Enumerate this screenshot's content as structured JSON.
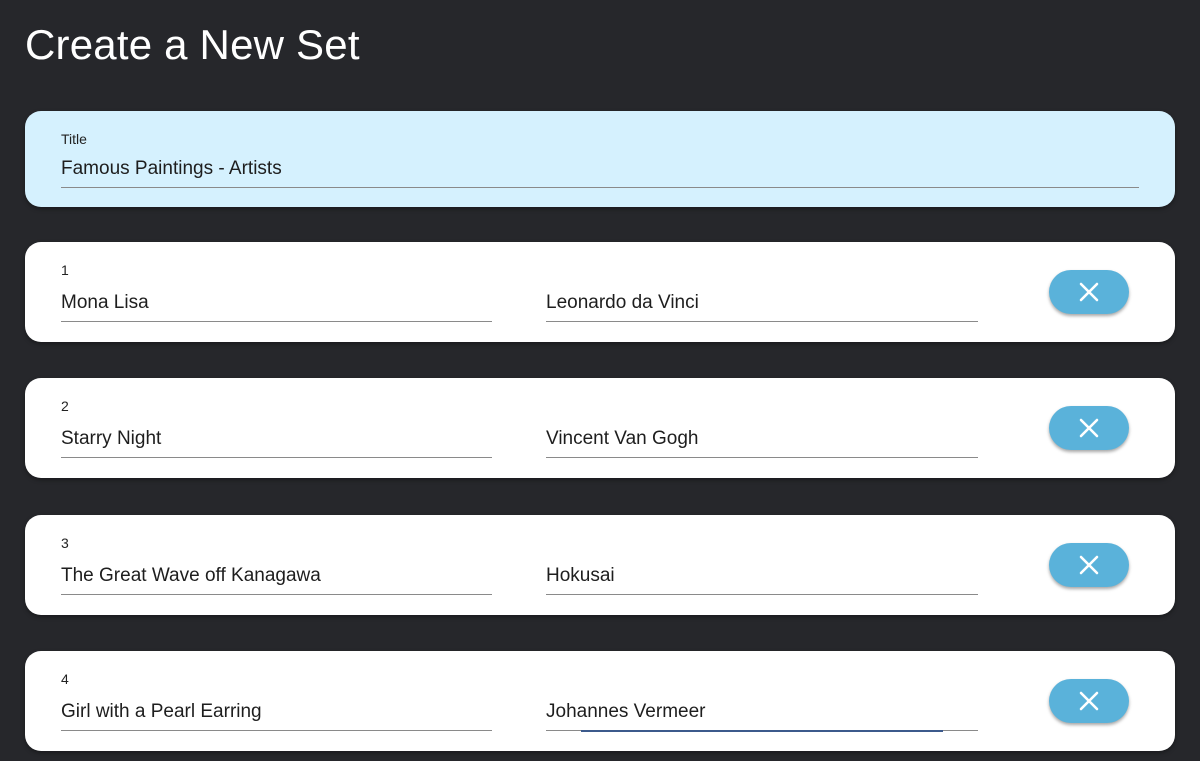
{
  "page": {
    "title": "Create a New Set"
  },
  "set_title": {
    "label": "Title",
    "value": "Famous Paintings - Artists"
  },
  "cards": [
    {
      "number": "1",
      "term": "Mona Lisa",
      "definition": "Leonardo da Vinci"
    },
    {
      "number": "2",
      "term": "Starry Night",
      "definition": "Vincent Van Gogh"
    },
    {
      "number": "3",
      "term": "The Great Wave off Kanagawa",
      "definition": "Hokusai"
    },
    {
      "number": "4",
      "term": "Girl with a Pearl Earring",
      "definition": "Johannes Vermeer"
    }
  ],
  "icons": {
    "delete": "close-icon"
  },
  "colors": {
    "background": "#26272b",
    "title_card": "#d5f1fe",
    "card": "#ffffff",
    "delete_button": "#5ab2da",
    "focus_underline": "#3c5a8c"
  }
}
